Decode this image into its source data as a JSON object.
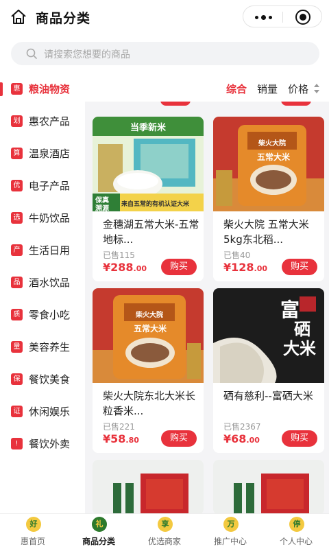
{
  "header": {
    "title": "商品分类"
  },
  "search": {
    "placeholder": "请搜索您想要的商品"
  },
  "sidebar": {
    "items": [
      {
        "badge": "惠",
        "label": "粮油物资",
        "active": true
      },
      {
        "badge": "划",
        "label": "惠农产品"
      },
      {
        "badge": "算",
        "label": "温泉酒店"
      },
      {
        "badge": "优",
        "label": "电子产品"
      },
      {
        "badge": "选",
        "label": "牛奶饮品"
      },
      {
        "badge": "产",
        "label": "生活日用"
      },
      {
        "badge": "品",
        "label": "酒水饮品"
      },
      {
        "badge": "质",
        "label": "零食小吃"
      },
      {
        "badge": "量",
        "label": "美容养生"
      },
      {
        "badge": "保",
        "label": "餐饮美食"
      },
      {
        "badge": "证",
        "label": "休闲娱乐"
      },
      {
        "badge": "!",
        "label": "餐饮外卖"
      }
    ]
  },
  "sort": {
    "comprehensive": "综合",
    "sales": "销量",
    "price": "价格"
  },
  "products": [
    {
      "name": "金穗湖五常大米-五常地标...",
      "sold": "已售115",
      "price_symbol": "¥",
      "price_int": "288",
      "price_dec": ".00",
      "buy": "购买",
      "img_text_top": "当季新米",
      "img_text_bottom": "来自五常的有机认证大米",
      "img_tag_a": "保真",
      "img_tag_b": "溯源"
    },
    {
      "name": "柴火大院 五常大米5kg东北稻...",
      "sold": "已售40",
      "price_symbol": "¥",
      "price_int": "128",
      "price_dec": ".00",
      "buy": "购买",
      "img_text_top": "柴火大院",
      "img_text_bottom": "五常大米"
    },
    {
      "name": "柴火大院东北大米长粒香米...",
      "sold": "已售221",
      "price_symbol": "¥",
      "price_int": "58",
      "price_dec": ".80",
      "buy": "购买",
      "img_text_top": "柴火大院",
      "img_text_bottom": "五常大米"
    },
    {
      "name": "硒有慈利--富硒大米",
      "sold": "已售2367",
      "price_symbol": "¥",
      "price_int": "68",
      "price_dec": ".00",
      "buy": "购买",
      "img_text_top": "富",
      "img_text_mid": "硒",
      "img_text_bottom": "大米"
    }
  ],
  "tabbar": {
    "items": [
      {
        "icon": "好",
        "label": "惠首页"
      },
      {
        "icon": "礼",
        "label": "商品分类",
        "active": true
      },
      {
        "icon": "享",
        "label": "优选商家"
      },
      {
        "icon": "万",
        "label": "推广中心"
      },
      {
        "icon": "停",
        "label": "个人中心"
      }
    ]
  },
  "colors": {
    "accent": "#e8323c",
    "content_bg": "#f4f4f6"
  }
}
